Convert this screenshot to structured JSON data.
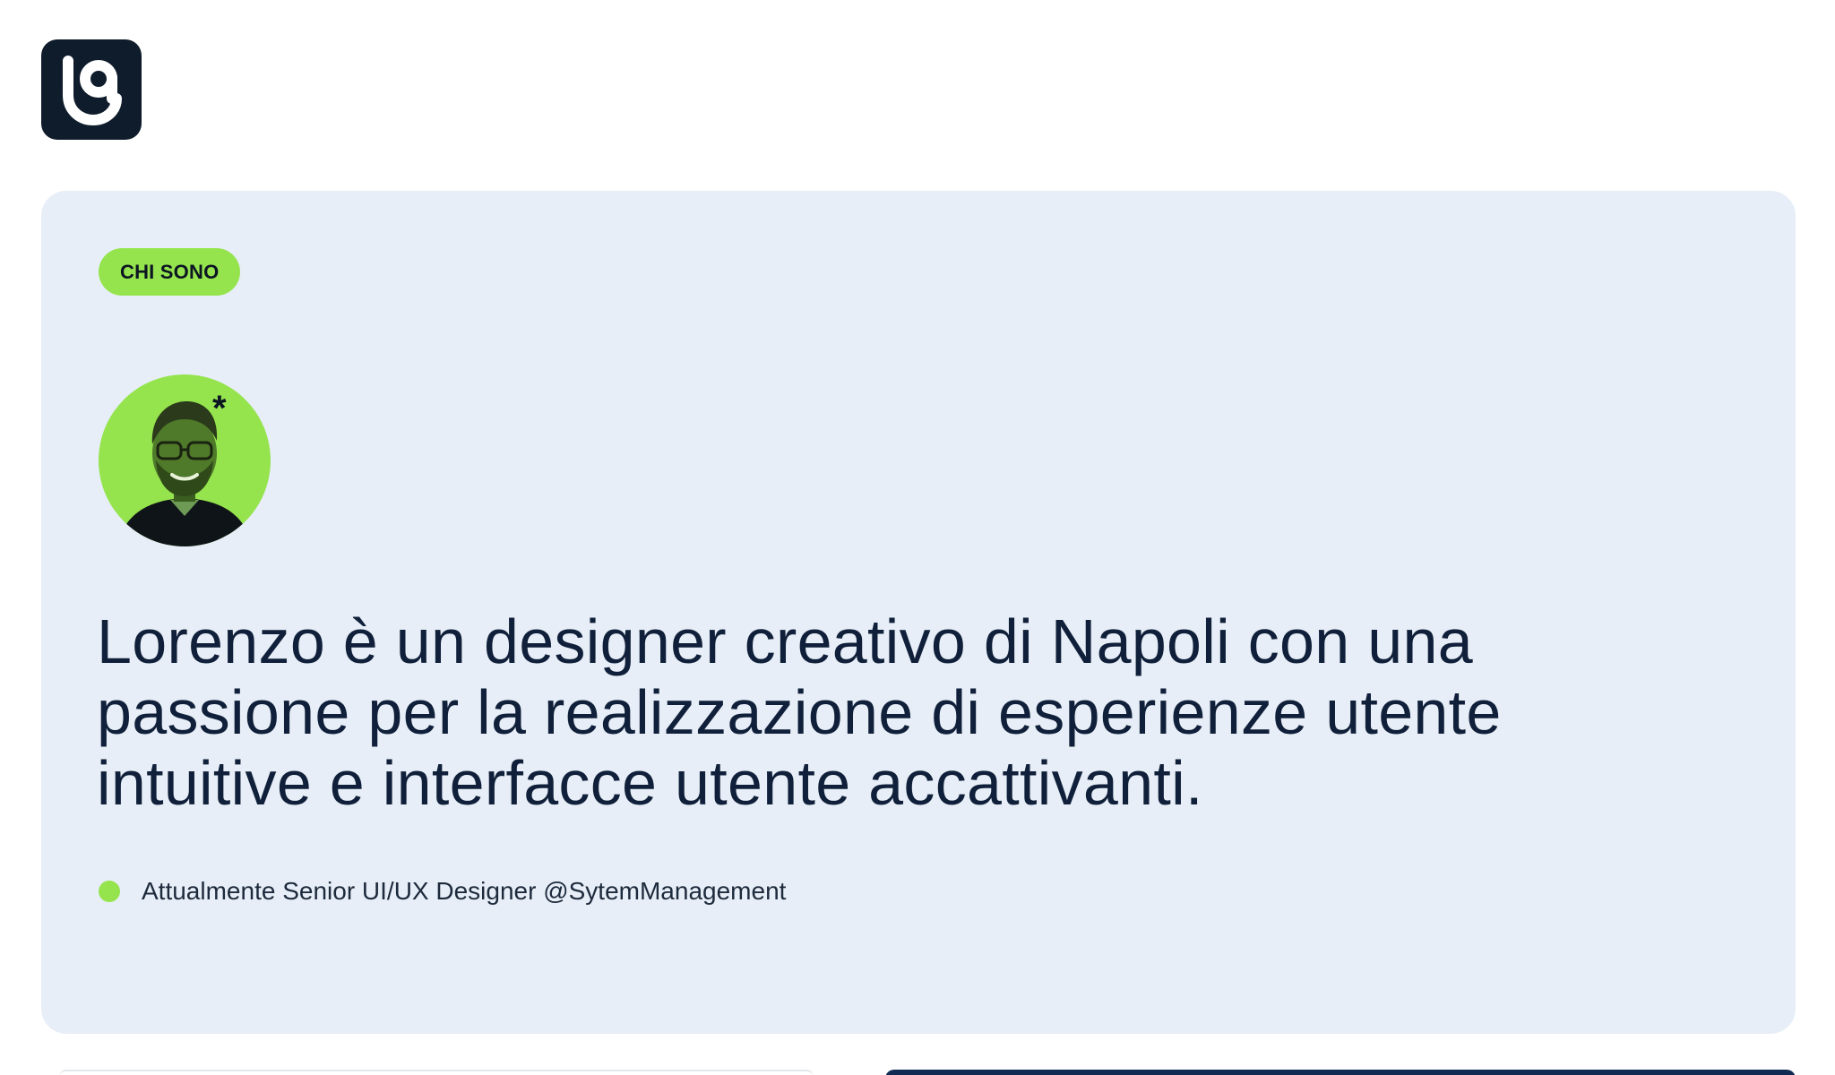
{
  "logo": {
    "icon": "lg-monogram-icon"
  },
  "card": {
    "badge_label": "CHI SONO",
    "avatar": {
      "icon": "profile-photo",
      "mark": "*"
    },
    "headline_lines": [
      "Lorenzo è un designer creativo di Napoli con una",
      "passione per la realizzazione di esperienze utente",
      "intuitive e interfacce utente accattivanti."
    ],
    "status_text": "Attualmente Senior UI/UX Designer @SytemManagement"
  },
  "colors": {
    "accent_green": "#95e44e",
    "card_bg": "#e7eef7",
    "dark_navy": "#0f1c2b",
    "text_primary": "#10203a",
    "bottom_card_navy": "#112a52"
  }
}
